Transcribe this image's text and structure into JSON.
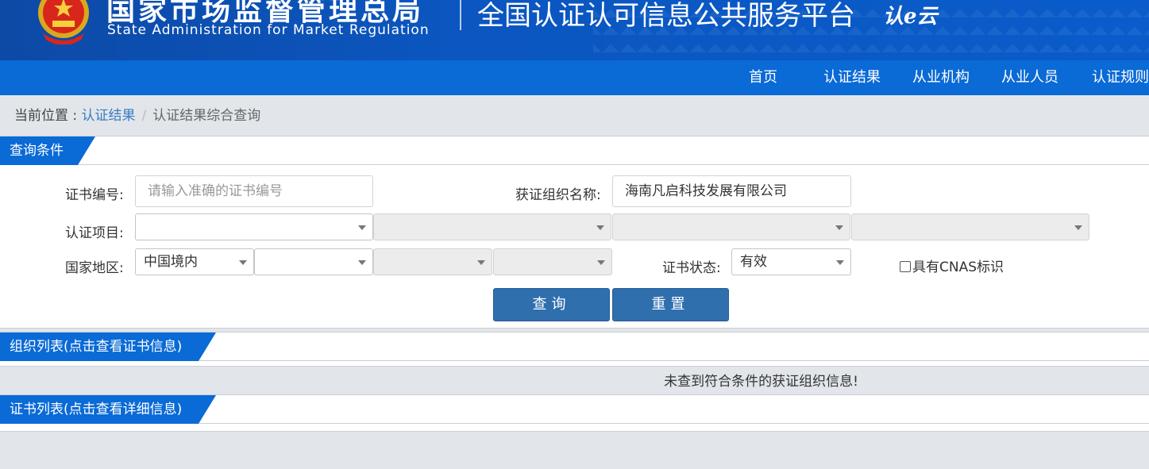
{
  "header": {
    "agency_cn": "国家市场监督管理总局",
    "agency_en": "State Administration  for  Market Regulation",
    "platform_title": "全国认证认可信息公共服务平台",
    "logo_text": "认e云"
  },
  "nav": {
    "items": [
      "首页",
      "认证结果",
      "从业机构",
      "从业人员",
      "认证规则"
    ]
  },
  "breadcrumb": {
    "prefix": "当前位置 : ",
    "link": "认证结果",
    "separator": "/",
    "current": "认证结果综合查询"
  },
  "query_panel": {
    "title": "查询条件",
    "cert_no_label": "证书编号:",
    "cert_no_placeholder": "请输入准确的证书编号",
    "org_name_label": "获证组织名称:",
    "org_name_value": "海南凡启科技发展有限公司",
    "project_label": "认证项目:",
    "region_label": "国家地区:",
    "region_value": "中国境内",
    "status_label": "证书状态:",
    "status_value": "有效",
    "cnas_label": "具有CNAS标识",
    "search_button": "查询",
    "reset_button": "重置"
  },
  "org_panel": {
    "title": "组织列表(点击查看证书信息)",
    "empty_message": "未查到符合条件的获证组织信息!"
  },
  "cert_panel": {
    "title": "证书列表(点击查看详细信息)"
  },
  "colors": {
    "header_bg": "#0b56c0",
    "nav_bg": "#0a6ad6",
    "button_bg": "#2f6fae",
    "link": "#3a7cc2"
  },
  "icons": [
    "national-emblem-icon",
    "chevron-down-icon",
    "checkbox-icon"
  ]
}
